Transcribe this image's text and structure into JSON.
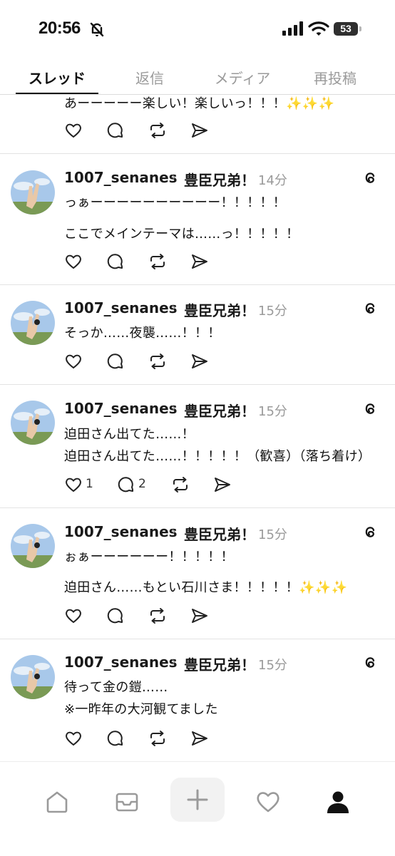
{
  "status_bar": {
    "time": "20:56",
    "battery": "53"
  },
  "tabs": [
    {
      "label": "スレッド"
    },
    {
      "label": "返信"
    },
    {
      "label": "メディア"
    },
    {
      "label": "再投稿"
    }
  ],
  "posts": [
    {
      "lines": [
        "あーーーーー楽しい！楽しいっ！！！✨✨✨"
      ]
    },
    {
      "username": "1007_senanes",
      "tag": "豊臣兄弟！",
      "time": "14分",
      "lines": [
        "っぁーーーーーーーーーー！！！！！",
        "ここでメインテーマは……っ！！！！！"
      ]
    },
    {
      "username": "1007_senanes",
      "tag": "豊臣兄弟！",
      "time": "15分",
      "lines": [
        "そっか……夜襲……！！！"
      ]
    },
    {
      "username": "1007_senanes",
      "tag": "豊臣兄弟！",
      "time": "15分",
      "lines": [
        "迫田さん出てた……！",
        "迫田さん出てた……！！！！！（歓喜）（落ち着け）"
      ],
      "likes": "1",
      "replies": "2"
    },
    {
      "username": "1007_senanes",
      "tag": "豊臣兄弟！",
      "time": "15分",
      "lines": [
        "ぉぁーーーーーー！！！！！",
        "迫田さん……もとい石川さま！！！！！✨✨✨"
      ]
    },
    {
      "username": "1007_senanes",
      "tag": "豊臣兄弟！",
      "time": "15分",
      "lines": [
        "待って金の鎧……",
        "※一昨年の大河観てました"
      ]
    }
  ],
  "icons": {
    "like": "heart-icon",
    "reply": "comment-icon",
    "repost": "repost-icon",
    "share": "send-icon",
    "threads": "threads-logo-icon"
  },
  "bottom_nav": [
    "home-icon",
    "inbox-icon",
    "compose-icon",
    "activity-icon",
    "profile-icon"
  ]
}
